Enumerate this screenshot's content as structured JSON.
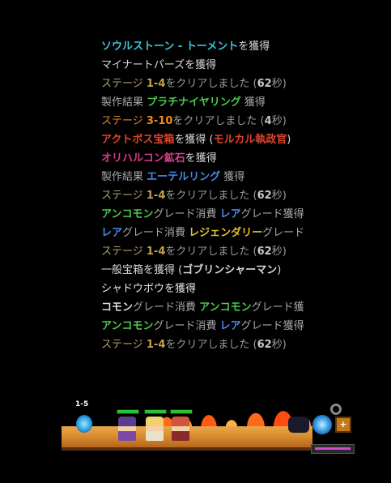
{
  "log": [
    {
      "segments": [
        {
          "text": "ソウルストーン - トーメント",
          "color": "#3fc2d8",
          "bold": true
        },
        {
          "text": "を獲得",
          "color": "#d8d8d8"
        }
      ]
    },
    {
      "segments": [
        {
          "text": "マイナートパーズを獲得",
          "color": "#d8d8d8"
        }
      ]
    },
    {
      "segments": [
        {
          "text": "ステージ ",
          "color": "#b4a074"
        },
        {
          "text": "1-4",
          "color": "#c8a24a",
          "bold": true
        },
        {
          "text": "をクリアしました (",
          "color": "#9a9a9a"
        },
        {
          "text": "62",
          "color": "#c8c8c8",
          "bold": true
        },
        {
          "text": "秒)",
          "color": "#9a9a9a"
        }
      ]
    },
    {
      "segments": [
        {
          "text": "製作結果 ",
          "color": "#a8a8a8"
        },
        {
          "text": "プラチナイヤリング",
          "color": "#4cc94c",
          "bold": true
        },
        {
          "text": " 獲得",
          "color": "#a8a8a8"
        }
      ]
    },
    {
      "segments": [
        {
          "text": "ステージ ",
          "color": "#e08a2a"
        },
        {
          "text": "3-10",
          "color": "#f08a20",
          "bold": true
        },
        {
          "text": "をクリアしました (",
          "color": "#9a9a9a"
        },
        {
          "text": "4",
          "color": "#c8c8c8",
          "bold": true
        },
        {
          "text": "秒)",
          "color": "#9a9a9a"
        }
      ]
    },
    {
      "segments": [
        {
          "text": "アクトボス宝箱",
          "color": "#e0442a",
          "bold": true
        },
        {
          "text": "を獲得 (",
          "color": "#d8d8d8"
        },
        {
          "text": "モルカル執政官",
          "color": "#e0442a",
          "bold": true
        },
        {
          "text": ")",
          "color": "#d8d8d8"
        }
      ]
    },
    {
      "segments": [
        {
          "text": "オリハルコン鉱石",
          "color": "#e03a8a",
          "bold": true
        },
        {
          "text": "を獲得",
          "color": "#d8d8d8"
        }
      ]
    },
    {
      "segments": [
        {
          "text": "製作結果 ",
          "color": "#a8a8a8"
        },
        {
          "text": "エーテルリング",
          "color": "#4a8ae8",
          "bold": true
        },
        {
          "text": " 獲得",
          "color": "#a8a8a8"
        }
      ]
    },
    {
      "segments": [
        {
          "text": "ステージ ",
          "color": "#b4a074"
        },
        {
          "text": "1-4",
          "color": "#c8a24a",
          "bold": true
        },
        {
          "text": "をクリアしました (",
          "color": "#9a9a9a"
        },
        {
          "text": "62",
          "color": "#c8c8c8",
          "bold": true
        },
        {
          "text": "秒)",
          "color": "#9a9a9a"
        }
      ]
    },
    {
      "segments": [
        {
          "text": "アンコモン",
          "color": "#4cc94c",
          "bold": true
        },
        {
          "text": "グレード消費 ",
          "color": "#a8a8a8"
        },
        {
          "text": "レア",
          "color": "#4a8ae8",
          "bold": true
        },
        {
          "text": "グレード獲得",
          "color": "#a8a8a8"
        }
      ]
    },
    {
      "segments": [
        {
          "text": "レア",
          "color": "#4a8ae8",
          "bold": true
        },
        {
          "text": "グレード消費 ",
          "color": "#a8a8a8"
        },
        {
          "text": "レジェンダリー",
          "color": "#e0c030",
          "bold": true
        },
        {
          "text": "グレード",
          "color": "#a8a8a8"
        }
      ]
    },
    {
      "segments": [
        {
          "text": "ステージ ",
          "color": "#b4a074"
        },
        {
          "text": "1-4",
          "color": "#c8a24a",
          "bold": true
        },
        {
          "text": "をクリアしました (",
          "color": "#9a9a9a"
        },
        {
          "text": "62",
          "color": "#c8c8c8",
          "bold": true
        },
        {
          "text": "秒)",
          "color": "#9a9a9a"
        }
      ]
    },
    {
      "segments": [
        {
          "text": "一般宝箱を獲得 (",
          "color": "#d8d8d8"
        },
        {
          "text": "ゴブリンシャーマン",
          "color": "#d8d8d8",
          "bold": true
        },
        {
          "text": ")",
          "color": "#d8d8d8"
        }
      ]
    },
    {
      "segments": [
        {
          "text": "シャドウボウを獲得",
          "color": "#e8e8e8"
        }
      ]
    },
    {
      "segments": [
        {
          "text": "コモン",
          "color": "#d8d8d8",
          "bold": true
        },
        {
          "text": "グレード消費 ",
          "color": "#a8a8a8"
        },
        {
          "text": "アンコモン",
          "color": "#4cc94c",
          "bold": true
        },
        {
          "text": "グレード獲",
          "color": "#a8a8a8"
        }
      ]
    },
    {
      "segments": [
        {
          "text": "アンコモン",
          "color": "#4cc94c",
          "bold": true
        },
        {
          "text": "グレード消費 ",
          "color": "#a8a8a8"
        },
        {
          "text": "レア",
          "color": "#4a8ae8",
          "bold": true
        },
        {
          "text": "グレード獲得",
          "color": "#a8a8a8"
        }
      ]
    },
    {
      "segments": [
        {
          "text": "ステージ ",
          "color": "#b4a074"
        },
        {
          "text": "1-4",
          "color": "#c8a24a",
          "bold": true
        },
        {
          "text": "をクリアしました (",
          "color": "#9a9a9a"
        },
        {
          "text": "62",
          "color": "#c8c8c8",
          "bold": true
        },
        {
          "text": "秒)",
          "color": "#9a9a9a"
        }
      ]
    }
  ],
  "game": {
    "stage_label": "1-5",
    "chest_button_symbol": "+"
  }
}
